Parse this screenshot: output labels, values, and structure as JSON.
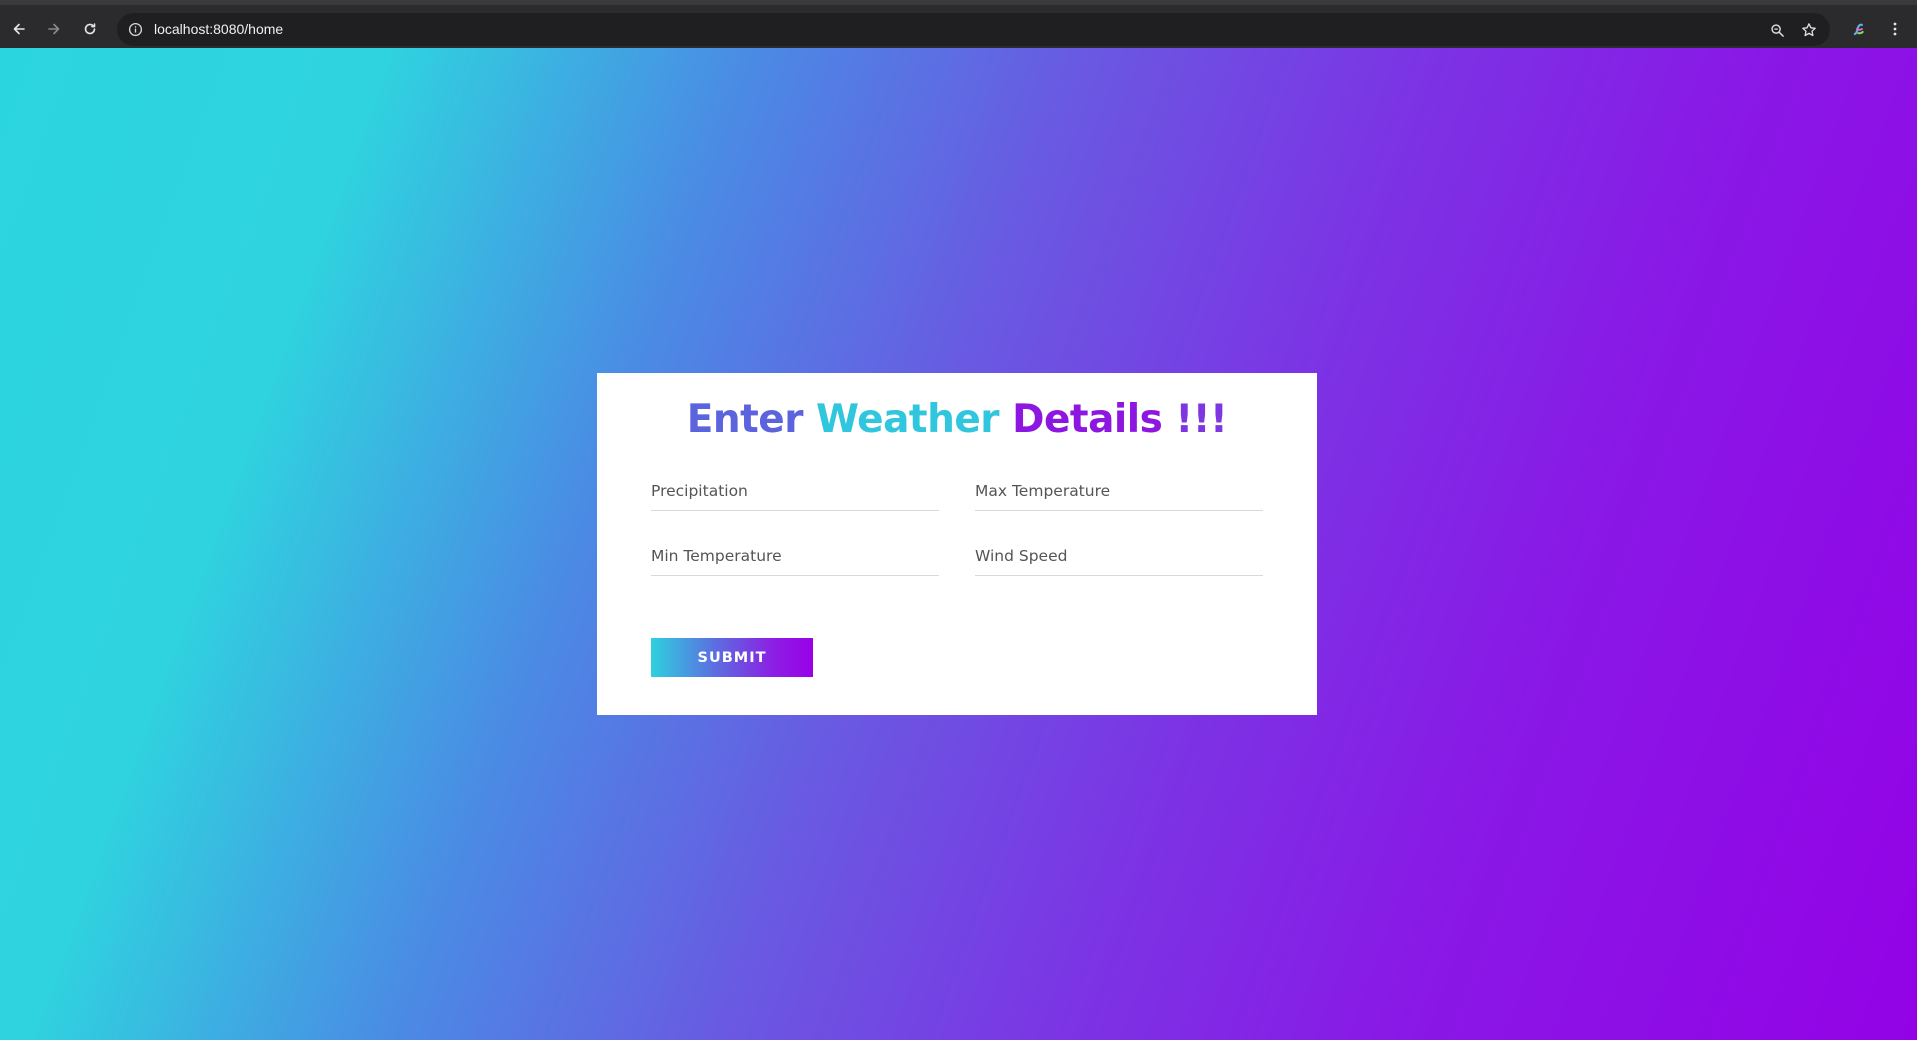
{
  "browser": {
    "url": "localhost:8080/home",
    "icons": {
      "back": "back-arrow-icon",
      "forward": "forward-arrow-icon",
      "reload": "reload-icon",
      "site_info": "info-icon",
      "zoom": "zoom-icon",
      "bookmark": "star-icon",
      "profile": "profile-icon",
      "menu": "kebab-menu-icon"
    }
  },
  "page": {
    "title": {
      "word1": "Enter",
      "word2": "Weather",
      "word3": "Details",
      "word4": "!!!"
    },
    "fields": {
      "precipitation": {
        "placeholder": "Precipitation",
        "value": ""
      },
      "max_temperature": {
        "placeholder": "Max Temperature",
        "value": ""
      },
      "min_temperature": {
        "placeholder": "Min Temperature",
        "value": ""
      },
      "wind_speed": {
        "placeholder": "Wind Speed",
        "value": ""
      }
    },
    "submit_label": "SUBMIT"
  },
  "colors": {
    "background_start": "#2bd5e0",
    "background_end": "#9302e6",
    "title_enter": "#5b63dd",
    "title_weather": "#2fc6de",
    "title_details": "#8d16e0",
    "card": "#ffffff"
  }
}
